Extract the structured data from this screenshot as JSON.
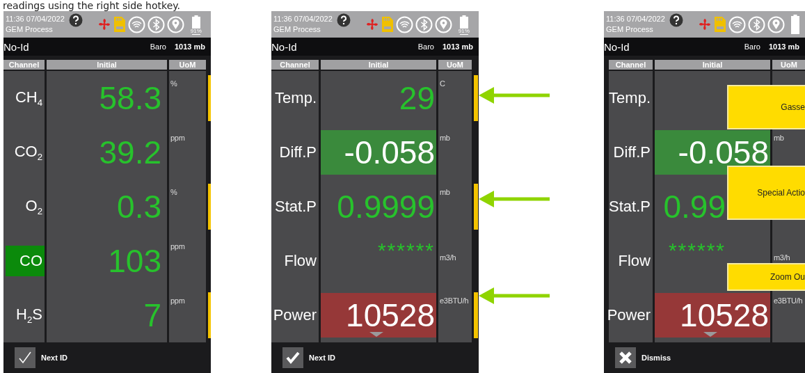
{
  "caption": "readings using the right side hotkey.",
  "screens": [
    {
      "status": {
        "time": "11:36 07/04/2022",
        "app": "GEM Process",
        "battery": "91%"
      },
      "id": "No-Id",
      "baro_label": "Baro",
      "baro_value": "1013 mb",
      "columns": [
        "Channel",
        "Initial",
        "UoM"
      ],
      "rows": [
        {
          "kind": "reading",
          "channel": "CH$_{4}$",
          "channel_marked": false,
          "value": "58.3",
          "value_marked": false,
          "unit": "%",
          "key_lit": true
        },
        {
          "kind": "reading",
          "channel": "CO$_{2}$",
          "channel_marked": false,
          "value": "39.2",
          "value_marked": false,
          "unit": "ppm",
          "key_lit": false
        },
        {
          "kind": "reading",
          "channel": "O$_{2}$",
          "channel_marked": false,
          "value": "0.3",
          "value_marked": false,
          "unit": "%",
          "key_lit": true
        },
        {
          "kind": "reading",
          "channel": "CO",
          "channel_marked": true,
          "color": "#0b8a0b",
          "value": "103",
          "value_marked": false,
          "unit": "ppm",
          "key_lit": false
        },
        {
          "kind": "reading",
          "channel": "H$_{2}$S",
          "channel_marked": false,
          "value": "7",
          "value_marked": false,
          "unit": "ppm",
          "key_lit": true
        }
      ],
      "scroll_down": false,
      "footer": {
        "kind": "check-thin",
        "label": "Next ID"
      }
    },
    {
      "status": {
        "time": "11:36 07/04/2022",
        "app": "GEM Process",
        "battery": "91%"
      },
      "id": "No-Id",
      "baro_label": "Baro",
      "baro_value": "1013 mb",
      "columns": [
        "Channel",
        "Initial",
        "UoM"
      ],
      "rows": [
        {
          "kind": "reading",
          "channel": "Temp.",
          "channel_marked": false,
          "value": "29",
          "value_marked": false,
          "unit": "C",
          "key_lit": true
        },
        {
          "kind": "reading",
          "channel": "Diff.P",
          "channel_marked": false,
          "value": "-0.058",
          "value_marked": true,
          "color": "#3a8a3c",
          "unit": "mb",
          "key_lit": false
        },
        {
          "kind": "reading",
          "channel": "Stat.P",
          "channel_marked": false,
          "value": "0.9999",
          "value_marked": false,
          "unit": "mb",
          "key_lit": true
        },
        {
          "kind": "stars",
          "channel": "Flow",
          "channel_marked": false,
          "value": "******",
          "value_marked": false,
          "unit": "m3/h",
          "key_lit": false
        },
        {
          "kind": "reading",
          "channel": "Power",
          "channel_marked": false,
          "value": "10528",
          "value_marked": true,
          "color": "#963838",
          "unit": "e3BTU/h",
          "key_lit": true
        }
      ],
      "scroll_down": true,
      "footer": {
        "kind": "check",
        "label": "Next ID"
      }
    },
    {
      "status": {
        "time": "11:36 07/04/2022",
        "app": "GEM Process"
      },
      "id": "No-Id",
      "baro_label": "Baro",
      "baro_value": "1013 mb",
      "columns": [
        "Channel",
        "Initial",
        "UoM"
      ],
      "rows": [
        {
          "kind": "reading",
          "channel": "Temp.",
          "channel_marked": false
        },
        {
          "kind": "reading",
          "channel": "Diff.P",
          "channel_marked": false,
          "value": "-0.058",
          "value_marked": true,
          "color": "#3a8a3c",
          "unit": "mb"
        },
        {
          "kind": "reading",
          "channel": "Stat.P",
          "channel_marked": false,
          "value": "0.99",
          "value_marked": false
        },
        {
          "kind": "stars",
          "channel": "Flow",
          "channel_marked": false,
          "value": "******",
          "value_marked": false,
          "unit": "m3/h"
        },
        {
          "kind": "reading",
          "channel": "Power",
          "channel_marked": false,
          "value": "10528",
          "value_marked": true,
          "color": "#963838",
          "unit": "e3BTU/h"
        }
      ],
      "scroll_down": true,
      "footer": {
        "kind": "cross",
        "label": "Dismiss"
      },
      "menu": [
        {
          "label": "Gasse"
        },
        {
          "label": "Special Actio"
        },
        {
          "label": "Zoom Ou"
        }
      ]
    }
  ]
}
